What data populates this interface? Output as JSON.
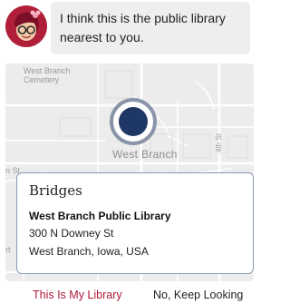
{
  "chat": {
    "message": "I think this is the public library nearest to you.",
    "avatar_icon": "libby-app-logo",
    "avatar_color": "#b01f3a"
  },
  "map": {
    "labels": {
      "cemetery": "West Branch Cemetery",
      "town": "West Branch",
      "street_4th": "4th St",
      "street_partial_left": "n St",
      "street_partial_bottom_left": "rt",
      "street_partial_bottom": "D"
    },
    "pin_color": "#1f3764"
  },
  "library_card": {
    "branch": "Bridges",
    "name": "West Branch Public Library",
    "address_line1": "300 N Downey St",
    "address_line2": "West Branch, Iowa, USA"
  },
  "actions": {
    "confirm_label": "This Is My Library",
    "decline_label": "No, Keep Looking",
    "accent_color": "#b0193a"
  }
}
